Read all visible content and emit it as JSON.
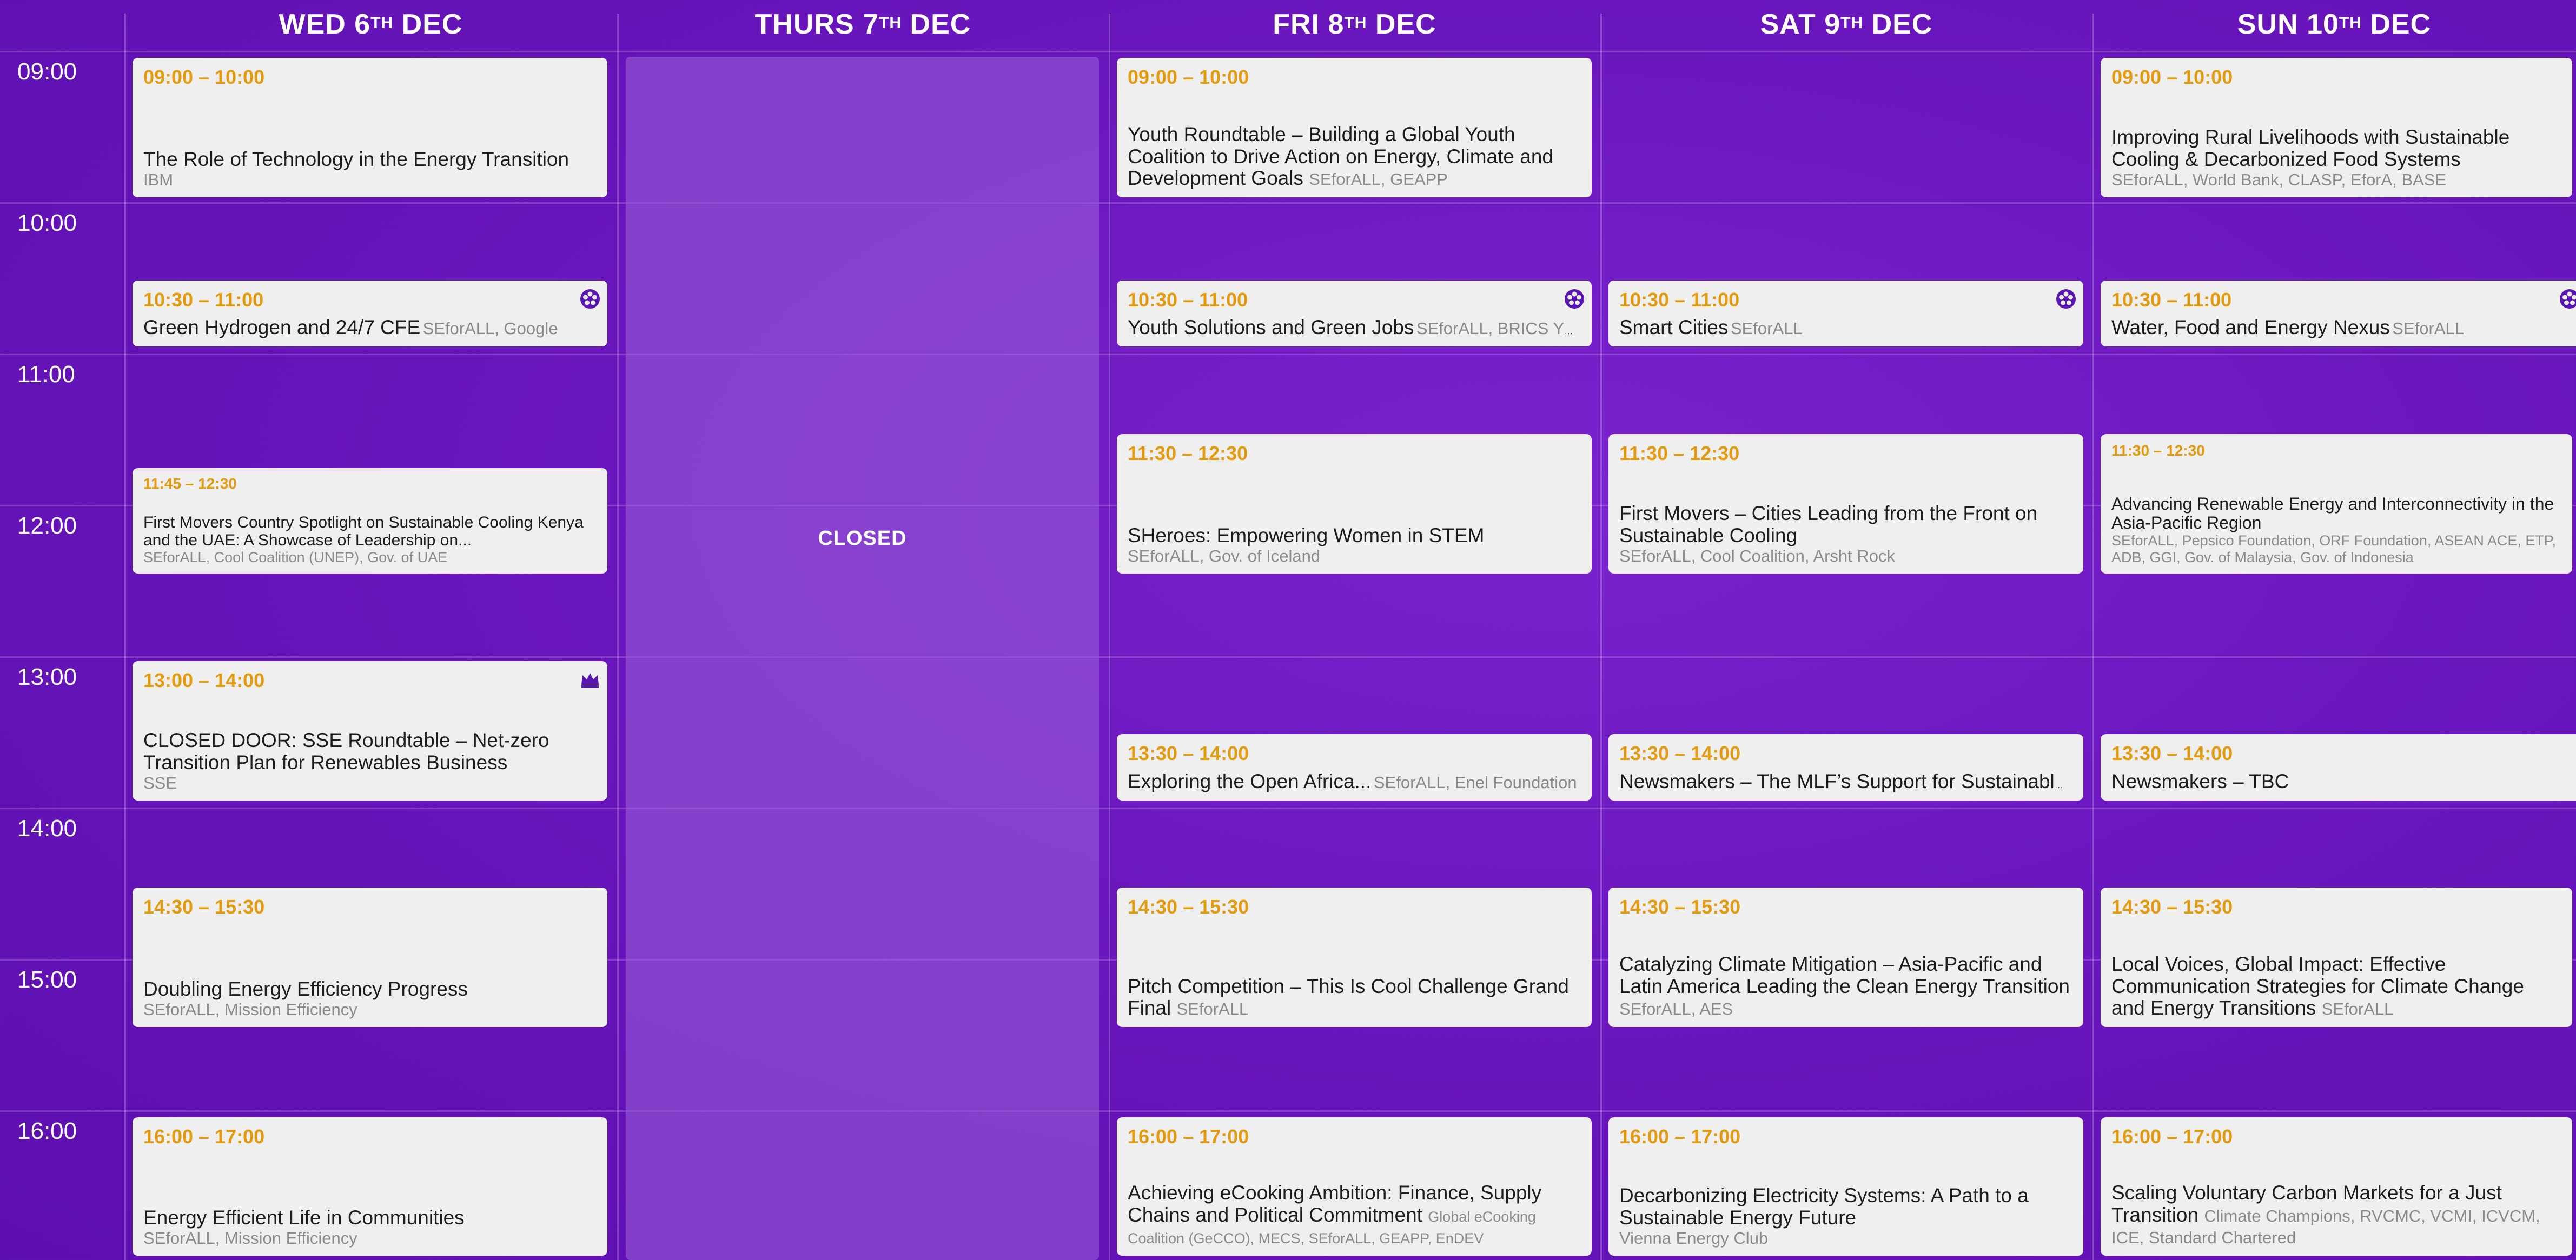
{
  "days": [
    {
      "label": "WED 6",
      "sup": "TH",
      "rest": " DEC"
    },
    {
      "label": "THURS 7",
      "sup": "TH",
      "rest": " DEC"
    },
    {
      "label": "FRI 8",
      "sup": "TH",
      "rest": " DEC"
    },
    {
      "label": "SAT 9",
      "sup": "TH",
      "rest": " DEC"
    },
    {
      "label": "SUN 10",
      "sup": "TH",
      "rest": " DEC"
    }
  ],
  "times": [
    "09:00",
    "10:00",
    "11:00",
    "12:00",
    "13:00",
    "14:00",
    "15:00",
    "16:00"
  ],
  "closed_label": "CLOSED",
  "colors": {
    "time_accent": "#e39a0f",
    "icon_purple": "#5a13b5",
    "card_bg": "#efefef"
  },
  "sessions": {
    "wed_0900": {
      "time": "09:00 – 10:00",
      "title": "The Role of Technology in the Energy Transition",
      "org": "IBM"
    },
    "wed_1030": {
      "time": "10:30 – 11:00",
      "title": "Green Hydrogen and 24/7 CFE",
      "org": "SEforALL, Google",
      "icon": "flower-icon"
    },
    "wed_1145": {
      "time": "11:45 – 12:30",
      "title": "First Movers Country Spotlight on Sustainable Cooling Kenya and the UAE: A Showcase of Leadership on...",
      "org": "SEforALL, Cool Coalition (UNEP), Gov. of UAE"
    },
    "wed_1300": {
      "time": "13:00 – 14:00",
      "title": "CLOSED DOOR: SSE Roundtable – Net-zero Transition Plan for Renewables Business",
      "org": "SSE",
      "icon": "crown-icon"
    },
    "wed_1430": {
      "time": "14:30 – 15:30",
      "title": "Doubling Energy Efficiency Progress",
      "org": "SEforALL, Mission Efficiency"
    },
    "wed_1600": {
      "time": "16:00 – 17:00",
      "title": "Energy Efficient Life in Communities",
      "org": "SEforALL, Mission Efficiency"
    },
    "fri_0900": {
      "time": "09:00 – 10:00",
      "title": "Youth Roundtable – Building a Global Youth Coalition to Drive Action on Energy, Climate and Development Goals",
      "org": "SEforALL, GEAPP"
    },
    "fri_1030": {
      "time": "10:30 – 11:00",
      "title": "Youth Solutions and Green Jobs",
      "org": "SEforALL, BRICS YEA...",
      "icon": "flower-icon"
    },
    "fri_1130": {
      "time": "11:30 – 12:30",
      "title": "SHeroes: Empowering Women in STEM",
      "org": "SEforALL, Gov. of Iceland"
    },
    "fri_1330": {
      "time": "13:30 – 14:00",
      "title": "Exploring the Open Africa...",
      "org": "SEforALL, Enel Foundation"
    },
    "fri_1430": {
      "time": "14:30 – 15:30",
      "title": "Pitch Competition – This Is Cool Challenge Grand Final",
      "org": "SEforALL"
    },
    "fri_1600": {
      "time": "16:00 – 17:00",
      "title": "Achieving eCooking Ambition: Finance, Supply Chains and Political Commitment",
      "org": "Global eCooking Coalition (GeCCO), MECS, SEforALL, GEAPP, EnDEV"
    },
    "sat_1030": {
      "time": "10:30 – 11:00",
      "title": "Smart Cities",
      "org": "SEforALL",
      "icon": "flower-icon"
    },
    "sat_1130": {
      "time": "11:30 – 12:30",
      "title": "First Movers – Cities Leading from the Front on Sustainable Cooling",
      "org": "SEforALL, Cool Coalition, Arsht Rock"
    },
    "sat_1330": {
      "time": "13:30 – 14:00",
      "title": "Newsmakers – The MLF’s Support for Sustainable..."
    },
    "sat_1430": {
      "time": "14:30 – 15:30",
      "title": "Catalyzing Climate Mitigation – Asia-Pacific and Latin America Leading the Clean Energy Transition",
      "org": "SEforALL, AES"
    },
    "sat_1600": {
      "time": "16:00 – 17:00",
      "title": "Decarbonizing Electricity Systems: A Path to a Sustainable Energy Future",
      "org": "Vienna Energy Club"
    },
    "sun_0900": {
      "time": "09:00 – 10:00",
      "title": "Improving Rural Livelihoods with Sustainable Cooling & Decarbonized Food Systems",
      "org": "SEforALL, World Bank, CLASP, EforA, BASE"
    },
    "sun_1030": {
      "time": "10:30 – 11:00",
      "title": "Water, Food and Energy Nexus",
      "org": "SEforALL",
      "icon": "flower-icon"
    },
    "sun_1130": {
      "time": "11:30 – 12:30",
      "title": "Advancing Renewable Energy and Interconnectivity in the Asia-Pacific Region",
      "org": "SEforALL, Pepsico Foundation, ORF Foundation, ASEAN ACE, ETP, ADB, GGI, Gov. of Malaysia, Gov. of Indonesia"
    },
    "sun_1330": {
      "time": "13:30 – 14:00",
      "title": "Newsmakers – TBC"
    },
    "sun_1430": {
      "time": "14:30 – 15:30",
      "title": "Local Voices, Global Impact: Effective Communication Strategies for Climate Change and Energy Transitions",
      "org": "SEforALL"
    },
    "sun_1600": {
      "time": "16:00 – 17:00",
      "title": "Scaling Voluntary Carbon Markets for a Just Transition",
      "org": "Climate Champions, RVCMC, VCMI, ICVCM, ICE, Standard Chartered"
    }
  }
}
